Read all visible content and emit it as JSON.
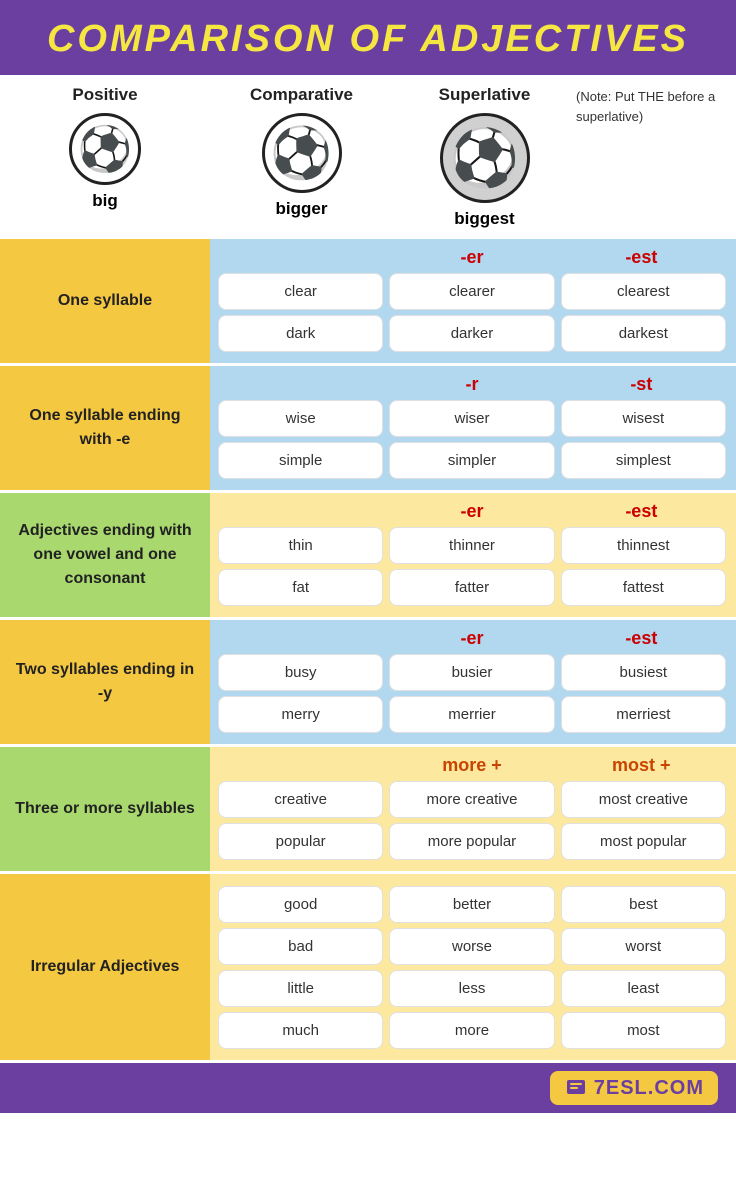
{
  "title": "COMPARISON OF ADJECTIVES",
  "columns": {
    "positive": "Positive",
    "comparative": "Comparative",
    "superlative": "Superlative"
  },
  "intro": {
    "positive": "big",
    "comparative": "bigger",
    "superlative": "biggest",
    "note": "(Note: Put THE before a superlative)"
  },
  "sections": [
    {
      "id": "one-syllable",
      "label": "One syllable",
      "colorClass": "sec-one-syl",
      "suffixComp": "-er",
      "suffixSuper": "-est",
      "suffixCompClass": "suffix-er",
      "suffixSuperClass": "suffix-est",
      "rows": [
        {
          "positive": "clear",
          "comparative": "clearer",
          "superlative": "clearest"
        },
        {
          "positive": "dark",
          "comparative": "darker",
          "superlative": "darkest"
        }
      ]
    },
    {
      "id": "one-syllable-e",
      "label": "One syllable ending with -e",
      "colorClass": "sec-one-e",
      "suffixComp": "-r",
      "suffixSuper": "-st",
      "suffixCompClass": "suffix-r",
      "suffixSuperClass": "suffix-st",
      "rows": [
        {
          "positive": "wise",
          "comparative": "wiser",
          "superlative": "wisest"
        },
        {
          "positive": "simple",
          "comparative": "simpler",
          "superlative": "simplest"
        }
      ]
    },
    {
      "id": "adj-cons",
      "label": "Adjectives ending with one vowel and one consonant",
      "colorClass": "sec-adj-cons",
      "suffixComp": "-er",
      "suffixSuper": "-est",
      "suffixCompClass": "suffix-er",
      "suffixSuperClass": "suffix-est",
      "rows": [
        {
          "positive": "thin",
          "comparative": "thinner",
          "superlative": "thinnest"
        },
        {
          "positive": "fat",
          "comparative": "fatter",
          "superlative": "fattest"
        }
      ]
    },
    {
      "id": "two-syl-y",
      "label": "Two syllables ending in -y",
      "colorClass": "sec-two-y",
      "suffixComp": "-er",
      "suffixSuper": "-est",
      "suffixCompClass": "suffix-er",
      "suffixSuperClass": "suffix-est",
      "rows": [
        {
          "positive": "busy",
          "comparative": "busier",
          "superlative": "busiest"
        },
        {
          "positive": "merry",
          "comparative": "merrier",
          "superlative": "merriest"
        }
      ]
    },
    {
      "id": "three-syl",
      "label": "Three or more syllables",
      "colorClass": "sec-three",
      "suffixComp": "more +",
      "suffixSuper": "most +",
      "suffixCompClass": "suffix-more",
      "suffixSuperClass": "suffix-most",
      "rows": [
        {
          "positive": "creative",
          "comparative": "more creative",
          "superlative": "most creative"
        },
        {
          "positive": "popular",
          "comparative": "more popular",
          "superlative": "most popular"
        }
      ]
    },
    {
      "id": "irregular",
      "label": "Irregular Adjectives",
      "colorClass": "sec-irreg",
      "suffixComp": null,
      "suffixSuper": null,
      "rows": [
        {
          "positive": "good",
          "comparative": "better",
          "superlative": "best"
        },
        {
          "positive": "bad",
          "comparative": "worse",
          "superlative": "worst"
        },
        {
          "positive": "little",
          "comparative": "less",
          "superlative": "least"
        },
        {
          "positive": "much",
          "comparative": "more",
          "superlative": "most"
        }
      ]
    }
  ],
  "footer": {
    "logo": "7ESL.COM"
  }
}
